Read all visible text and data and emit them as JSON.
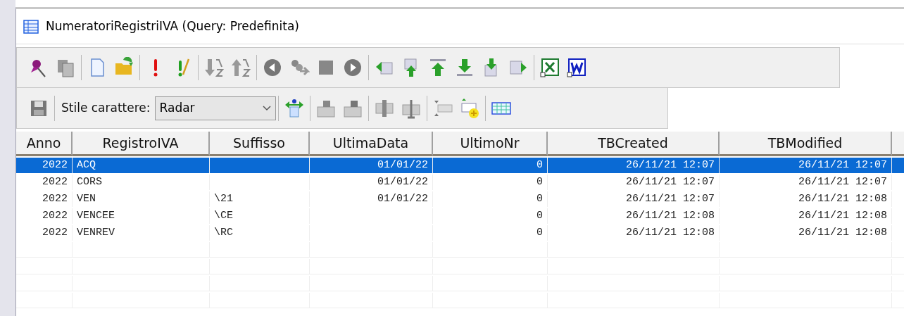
{
  "window": {
    "title": "NumeratoriRegistriIVA (Query: Predefinita)"
  },
  "toolbar_2": {
    "style_label": "Stile carattere:",
    "style_select": {
      "value": "Radar"
    }
  },
  "table": {
    "columns": [
      "Anno",
      "RegistroIVA",
      "Suffisso",
      "UltimaData",
      "UltimoNr",
      "TBCreated",
      "TBModified"
    ],
    "rows": [
      {
        "selected": true,
        "cells": [
          "2022",
          "ACQ",
          "",
          "01/01/22",
          "0",
          "26/11/21 12:07",
          "26/11/21 12:07"
        ]
      },
      {
        "selected": false,
        "cells": [
          "2022",
          "CORS",
          "",
          "01/01/22",
          "0",
          "26/11/21 12:07",
          "26/11/21 12:07"
        ]
      },
      {
        "selected": false,
        "cells": [
          "2022",
          "VEN",
          "\\21",
          "01/01/22",
          "0",
          "26/11/21 12:07",
          "26/11/21 12:08"
        ]
      },
      {
        "selected": false,
        "cells": [
          "2022",
          "VENCEE",
          "\\CE",
          "",
          "0",
          "26/11/21 12:08",
          "26/11/21 12:08"
        ]
      },
      {
        "selected": false,
        "cells": [
          "2022",
          "VENREV",
          "\\RC",
          "",
          "0",
          "26/11/21 12:08",
          "26/11/21 12:08"
        ]
      }
    ]
  }
}
